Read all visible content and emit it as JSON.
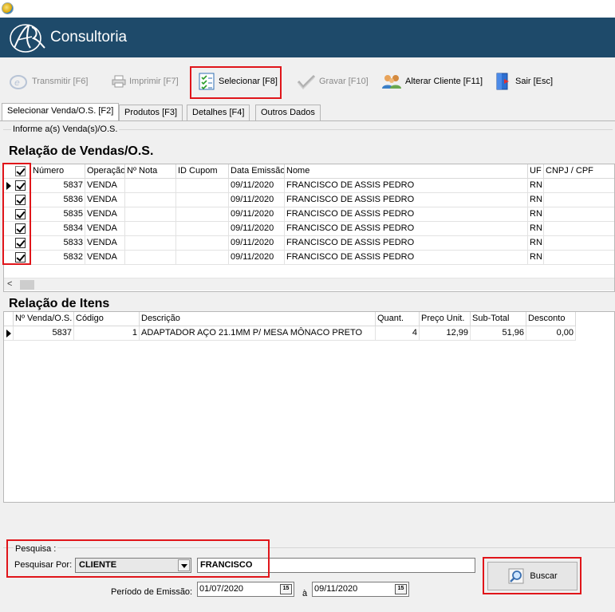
{
  "brand": {
    "name": "Consultoria"
  },
  "toolbar": {
    "transmitir": "Transmitir [F6]",
    "imprimir": "Imprimir  [F7]",
    "selecionar": "Selecionar [F8]",
    "gravar": "Gravar [F10]",
    "alterar_cliente": "Alterar Cliente [F11]",
    "sair": "Sair    [Esc]"
  },
  "tabs": [
    "Selecionar Venda/O.S. [F2]",
    "Produtos [F3]",
    "Detalhes [F4]",
    "Outros Dados"
  ],
  "group_label": "Informe a(s) Venda(s)/O.S.",
  "vendas": {
    "title": "Relação de Vendas/O.S.",
    "columns": [
      "Número",
      "Operação",
      "Nº Nota",
      "ID Cupom",
      "Data Emissão",
      "Nome",
      "UF",
      "CNPJ / CPF"
    ],
    "rows": [
      {
        "numero": "5837",
        "operacao": "VENDA",
        "nota": "",
        "cupom": "",
        "data": "09/11/2020",
        "nome": "FRANCISCO DE ASSIS PEDRO",
        "uf": "RN",
        "cnpj": ""
      },
      {
        "numero": "5836",
        "operacao": "VENDA",
        "nota": "",
        "cupom": "",
        "data": "09/11/2020",
        "nome": "FRANCISCO DE ASSIS PEDRO",
        "uf": "RN",
        "cnpj": ""
      },
      {
        "numero": "5835",
        "operacao": "VENDA",
        "nota": "",
        "cupom": "",
        "data": "09/11/2020",
        "nome": "FRANCISCO DE ASSIS PEDRO",
        "uf": "RN",
        "cnpj": ""
      },
      {
        "numero": "5834",
        "operacao": "VENDA",
        "nota": "",
        "cupom": "",
        "data": "09/11/2020",
        "nome": "FRANCISCO DE ASSIS PEDRO",
        "uf": "RN",
        "cnpj": ""
      },
      {
        "numero": "5833",
        "operacao": "VENDA",
        "nota": "",
        "cupom": "",
        "data": "09/11/2020",
        "nome": "FRANCISCO DE ASSIS PEDRO",
        "uf": "RN",
        "cnpj": ""
      },
      {
        "numero": "5832",
        "operacao": "VENDA",
        "nota": "",
        "cupom": "",
        "data": "09/11/2020",
        "nome": "FRANCISCO DE ASSIS PEDRO",
        "uf": "RN",
        "cnpj": ""
      }
    ]
  },
  "itens": {
    "title": "Relação de Itens",
    "columns": [
      "Nº Venda/O.S.",
      "Código",
      "Descrição",
      "Quant.",
      "Preço Unit.",
      "Sub-Total",
      "Desconto"
    ],
    "rows": [
      {
        "venda": "5837",
        "codigo": "1",
        "descricao": "ADAPTADOR AÇO 21.1MM P/ MESA MÔNACO PRETO",
        "quant": "4",
        "preco": "12,99",
        "subtotal": "51,96",
        "desconto": "0,00"
      }
    ]
  },
  "pesquisa": {
    "label": "Pesquisa :",
    "por_label": "Pesquisar Por:",
    "por_value": "CLIENTE",
    "query": "FRANCISCO",
    "periodo_label": "Período de Emissão:",
    "data_inicio": "01/07/2020",
    "separator": "à",
    "data_fim": "09/11/2020",
    "calendar_glyph": "15",
    "buscar": "Buscar"
  }
}
